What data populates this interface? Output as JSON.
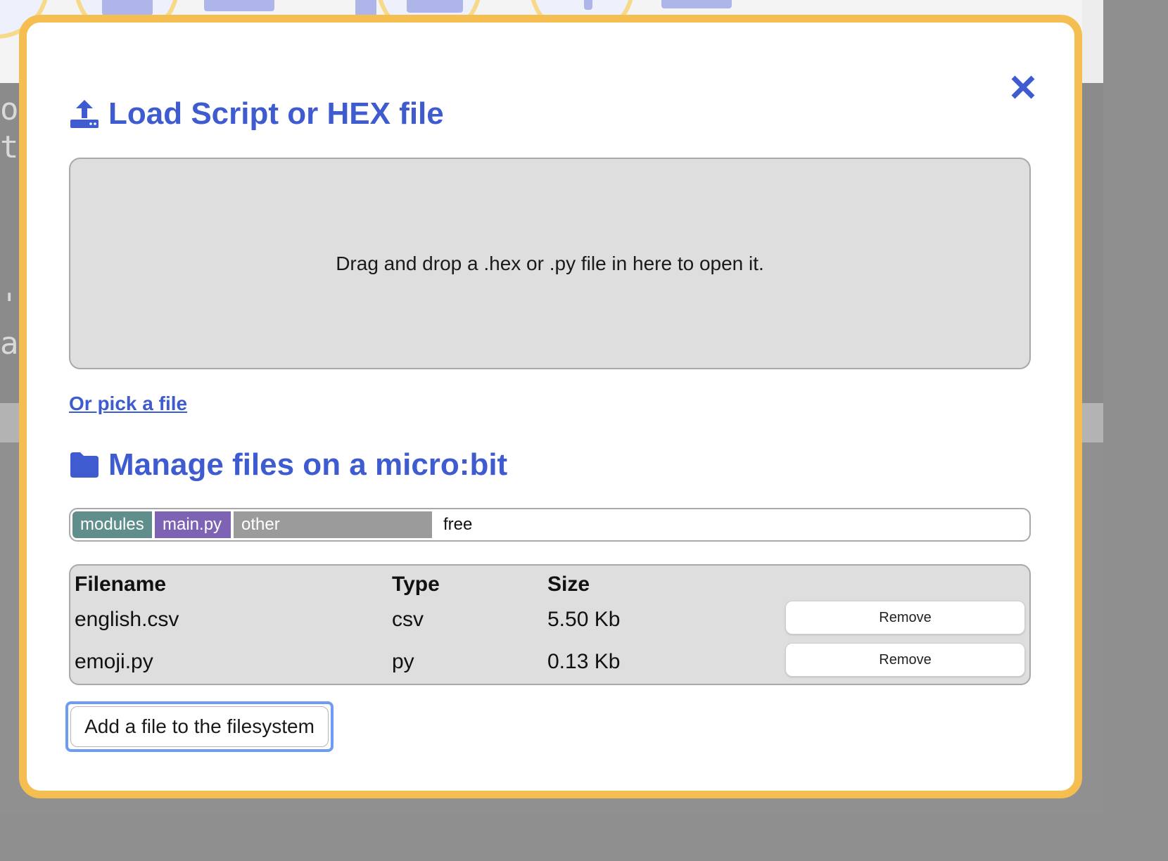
{
  "load_section": {
    "title": "Load Script or HEX file",
    "icon": "upload-icon",
    "drop_zone_text": "Drag and drop a .hex or .py file in here to open it.",
    "pick_file_link": "Or pick a file"
  },
  "manage_section": {
    "title": "Manage files on a micro:bit",
    "icon": "folder-icon",
    "usage_bar": {
      "segments": [
        {
          "label": "modules",
          "color": "#5f8e8c"
        },
        {
          "label": "main.py",
          "color": "#7e63b5"
        },
        {
          "label": "other",
          "color": "#9b9b9b"
        },
        {
          "label": "free",
          "color": "#ffffff"
        }
      ]
    },
    "table": {
      "headers": [
        "Filename",
        "Type",
        "Size"
      ],
      "rows": [
        {
          "filename": "english.csv",
          "type": "csv",
          "size": "5.50 Kb",
          "action": "Remove"
        },
        {
          "filename": "emoji.py",
          "type": "py",
          "size": "0.13 Kb",
          "action": "Remove"
        }
      ]
    },
    "add_file_button": "Add a file to the filesystem"
  },
  "close_icon": "close-icon",
  "colors": {
    "accent": "#3f5bd0",
    "modal_border": "#f4bf50",
    "focus_ring": "#6d9bf5"
  }
}
